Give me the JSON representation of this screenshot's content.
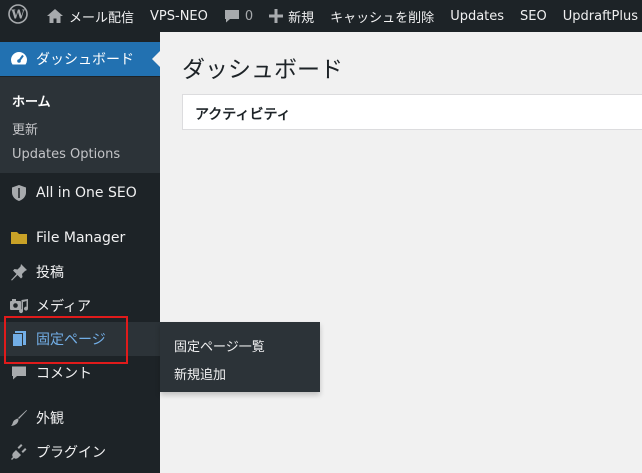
{
  "adminbar": {
    "site_name": "メール配信",
    "vps_neo": "VPS-NEO",
    "comments_count": "0",
    "new_label": "新規",
    "cache_clear": "キャッシュを削除",
    "updates": "Updates",
    "seo": "SEO",
    "updraft": "UpdraftPlus"
  },
  "sidebar": {
    "dashboard": "ダッシュボード",
    "submenu": {
      "home": "ホーム",
      "updates": "更新",
      "updates_options": "Updates Options"
    },
    "aioseo": "All in One SEO",
    "file_manager": "File Manager",
    "posts": "投稿",
    "media": "メディア",
    "pages": "固定ページ",
    "comments": "コメント",
    "appearance": "外観",
    "plugins": "プラグイン"
  },
  "flyout": {
    "all_pages": "固定ページ一覧",
    "add_new": "新規追加"
  },
  "main": {
    "title": "ダッシュボード",
    "activity_title": "アクティビティ"
  },
  "colors": {
    "adminbar_bg": "#1d2327",
    "accent": "#2271b1",
    "highlight": "#e01b1b",
    "hover_text": "#72aee6"
  }
}
